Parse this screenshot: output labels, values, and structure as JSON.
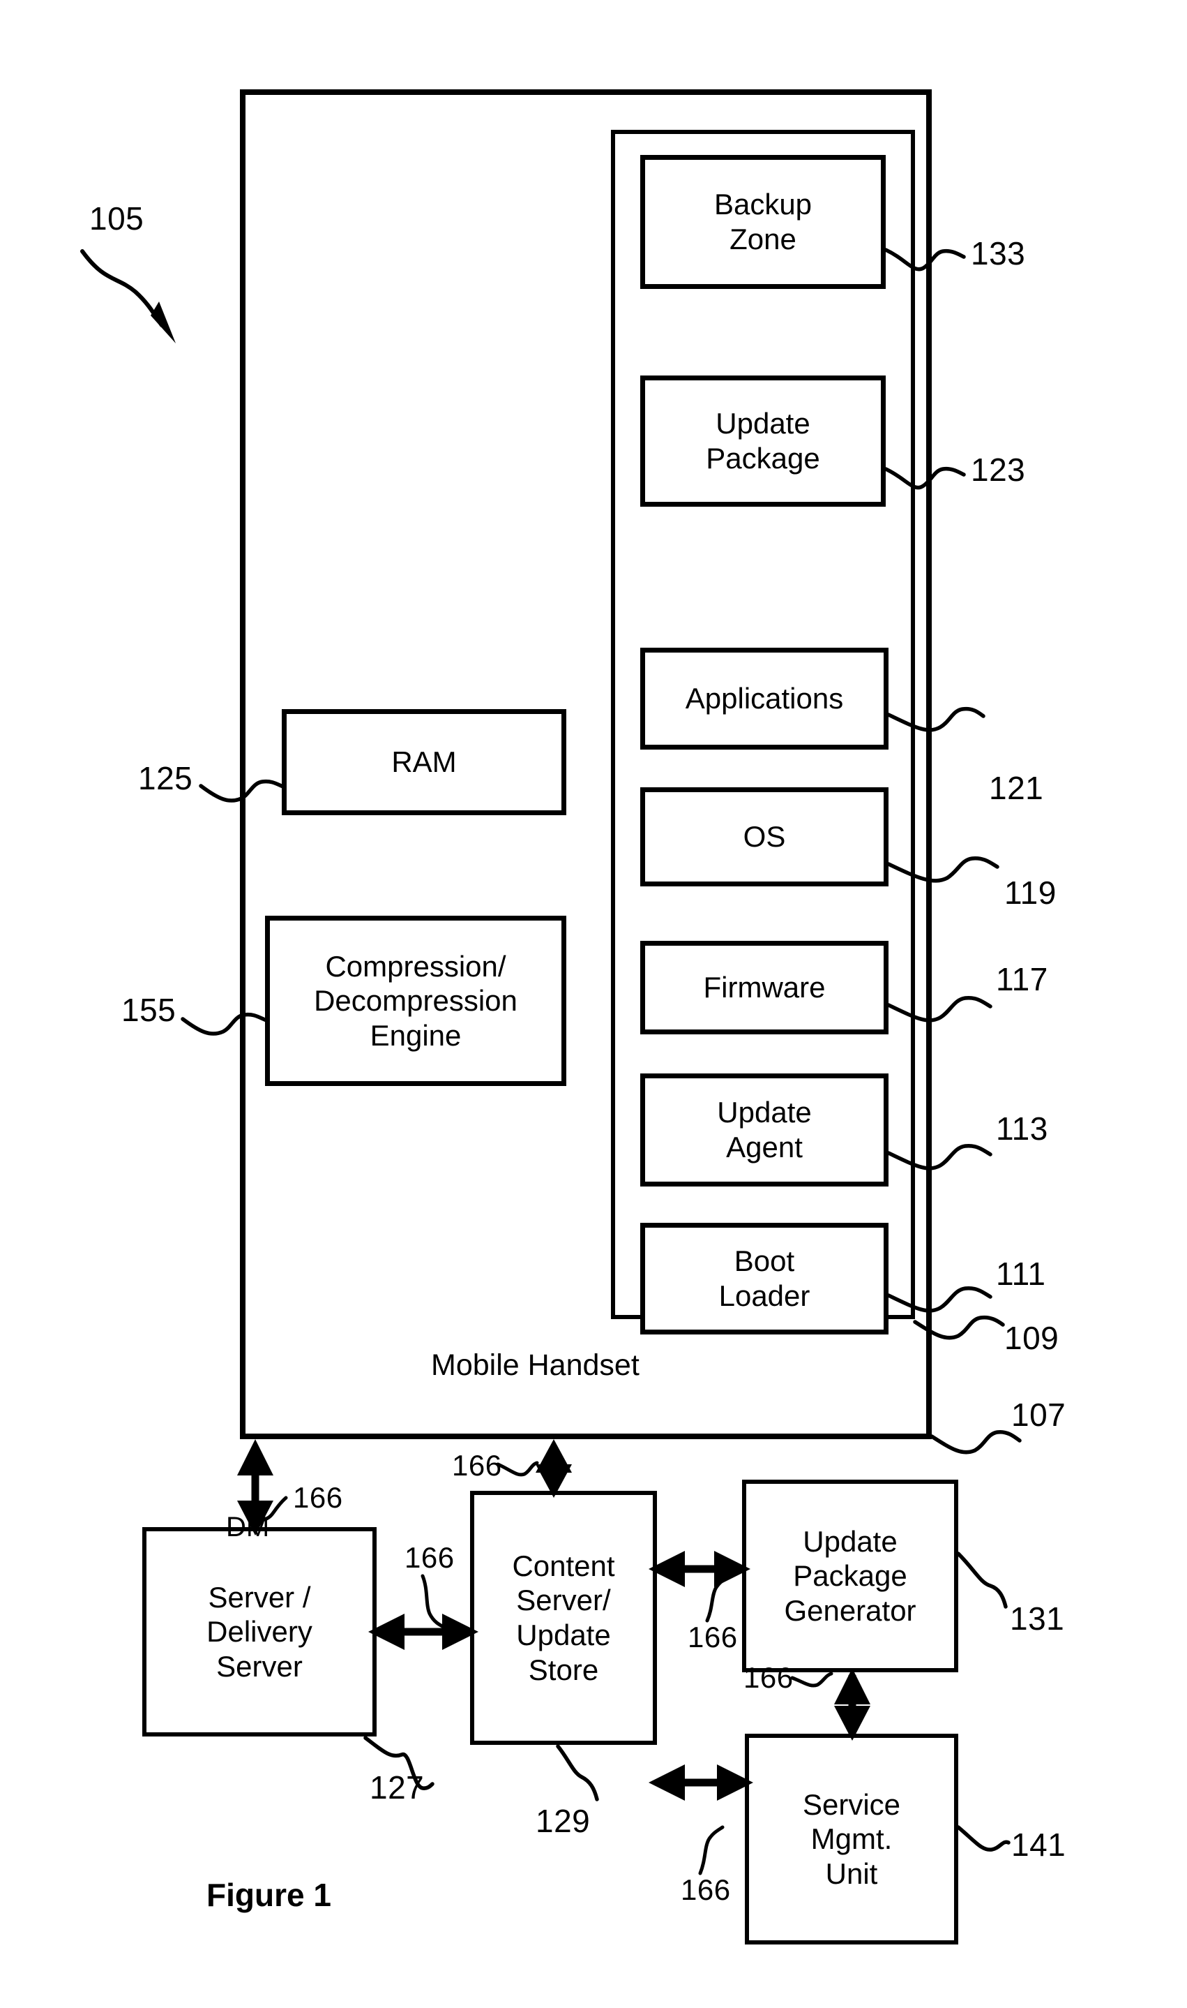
{
  "figure": {
    "caption": "Figure 1",
    "system_ref": "105",
    "device_label": "Mobile Handset"
  },
  "handset": {
    "label": "Mobile Handset",
    "ref_outer": "107",
    "ref_memory": "109",
    "memory_blocks": [
      {
        "label": "Backup\nZone",
        "ref": "133"
      },
      {
        "label": "Update\nPackage",
        "ref": "123"
      },
      {
        "label": "Applications",
        "ref": "121"
      },
      {
        "label": "OS",
        "ref": "119"
      },
      {
        "label": "Firmware",
        "ref": "117"
      },
      {
        "label": "Update\nAgent",
        "ref": "113"
      },
      {
        "label": "Boot\nLoader",
        "ref": "111"
      }
    ],
    "left_blocks": [
      {
        "label": "RAM",
        "ref": "125"
      },
      {
        "label": "Compression/\nDecompression\nEngine",
        "ref": "155"
      }
    ]
  },
  "network": {
    "link_label": "166",
    "dm_label": "DM",
    "nodes": [
      {
        "label": "Server /\nDelivery\nServer",
        "ref": "127"
      },
      {
        "label": "Content\nServer/\nUpdate\nStore",
        "ref": "129"
      },
      {
        "label": "Update\nPackage\nGenerator",
        "ref": "131"
      },
      {
        "label": "Service\nMgmt.\nUnit",
        "ref": "141"
      }
    ]
  },
  "link_refs": {
    "handset_to_dm": "166",
    "handset_to_content": "166",
    "dm_to_content": "166",
    "content_to_generator": "166",
    "generator_to_service": "166",
    "content_to_service": "166"
  },
  "colors": {
    "ink": "#000000",
    "paper": "#ffffff"
  }
}
